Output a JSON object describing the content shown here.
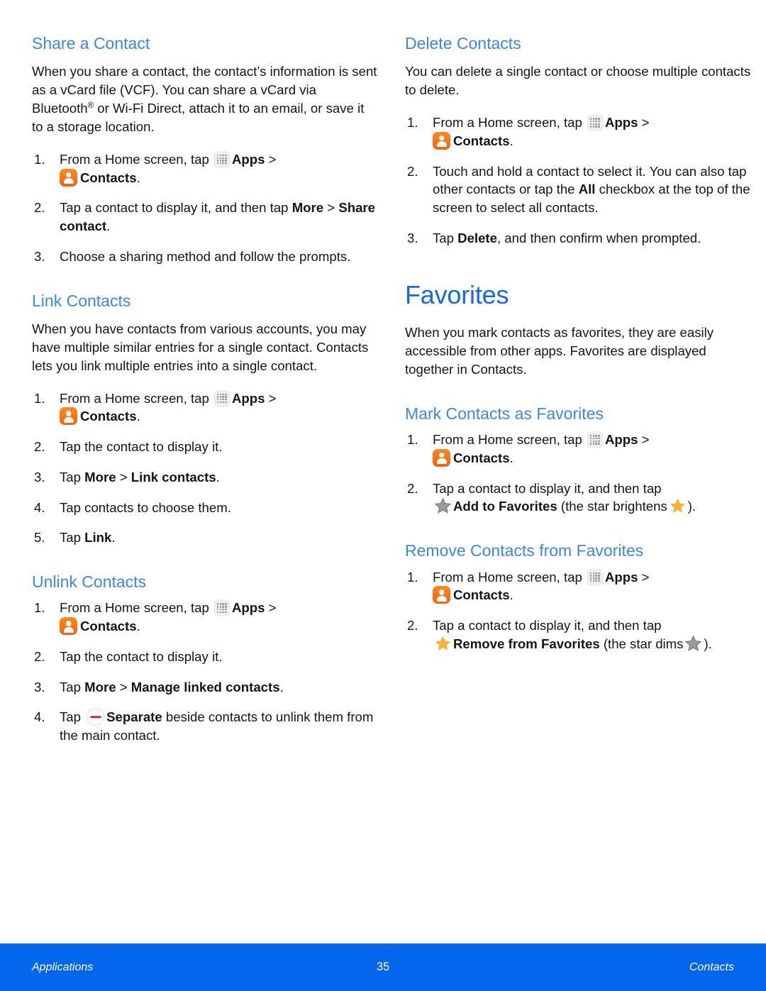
{
  "page": {
    "number": "35",
    "footer_left": "Applications",
    "footer_right": "Contacts",
    "footer_bg": "#0466ec",
    "heading_color": "#3b86f0",
    "title_color": "#1668e3"
  },
  "icons": {
    "apps": "apps-grid-icon",
    "contacts": "contacts-app-icon",
    "separate": "separate-minus-icon",
    "star_dim": "star-dim-icon",
    "star_bright": "star-bright-icon",
    "star_bright_color": "#fcb034",
    "star_dim_color": "#8d8d8d",
    "contacts_icon_color": "#f4610c",
    "separate_bar_color": "#d8232a"
  },
  "labels": {
    "apps": "Apps",
    "contacts": "Contacts",
    "separate": "Separate",
    "add_to_favorites": "Add to Favorites",
    "remove_from_favorites": "Remove from Favorites"
  },
  "left_column": {
    "share_a_contact": {
      "heading": "Share a Contact",
      "intro_1": "When you share a contact, the contact’s information is sent as a vCard file (VCF). You can share a vCard via Bluetooth",
      "intro_reg": "®",
      "intro_2": " or Wi-Fi Direct, attach it to an email, or save it to a storage location.",
      "step1_num": "1.",
      "step1_a": "From a Home screen, tap",
      "step1_b": ">",
      "step1_c": ".",
      "step2_num": "2.",
      "step2_a": "Tap a contact to display it, and then tap",
      "step2_more": "More",
      "step2_gt": ">",
      "step2_share": "Share contact",
      "step2_end": ".",
      "step3_num": "3.",
      "step3_text": "Choose a sharing method and follow the prompts."
    },
    "link_contacts": {
      "heading": "Link Contacts",
      "intro": "When you have contacts from various accounts, you may have multiple similar entries for a single contact. Contacts lets you link multiple entries into a single contact.",
      "step1_num": "1.",
      "step1_a": "From a Home screen, tap",
      "step1_b": ">",
      "step1_c": ".",
      "step2_num": "2.",
      "step2_text": "Tap the contact to display it.",
      "step3_num": "3.",
      "step3_a": "Tap",
      "step3_more": "More",
      "step3_gt": ">",
      "step3_link": "Link contacts",
      "step3_end": ".",
      "step4_num": "4.",
      "step4_text": "Tap contacts to choose them.",
      "step5_num": "5.",
      "step5_a": "Tap",
      "step5_link": "Link",
      "step5_end": "."
    },
    "unlink_contacts": {
      "heading": "Unlink Contacts",
      "step1_num": "1.",
      "step1_a": "From a Home screen, tap",
      "step1_b": ">",
      "step1_c": ".",
      "step2_num": "2.",
      "step2_text": "Tap the contact to display it.",
      "step3_num": "3.",
      "step3_a": "Tap",
      "step3_more": "More",
      "step3_gt": ">",
      "step3_manage": "Manage linked contacts",
      "step3_end": ".",
      "step4_num": "4.",
      "step4_a": "Tap",
      "step4_sep": "Separate",
      "step4_b": "beside contacts to unlink them from the main contact."
    }
  },
  "right_column": {
    "delete_contacts": {
      "heading": "Delete Contacts",
      "intro": "You can delete a single contact or choose multiple contacts to delete.",
      "step1_num": "1.",
      "step1_a": "From a Home screen, tap",
      "step1_b": ">",
      "step1_c": ".",
      "step2_num": "2.",
      "step2_a": "Touch and hold a contact to select it. You can also tap other contacts or tap the",
      "step2_all": "All",
      "step2_b": "checkbox at the top of the screen to select all contacts.",
      "step3_num": "3.",
      "step3_a": "Tap",
      "step3_delete": "Delete",
      "step3_b": ", and then confirm when prompted."
    },
    "favorites": {
      "title": "Favorites",
      "intro": "When you mark contacts as favorites, they are easily accessible from other apps. Favorites are displayed together in Contacts."
    },
    "mark_favorites": {
      "heading": "Mark Contacts as Favorites",
      "step1_num": "1.",
      "step1_a": "From a Home screen, tap",
      "step1_b": ">",
      "step1_c": ".",
      "step2_num": "2.",
      "step2_a": "Tap a contact to display it, and then tap",
      "step2_label": "Add to Favorites",
      "step2_b": "(the star brightens",
      "step2_c": ")."
    },
    "remove_favorites": {
      "heading": "Remove Contacts from Favorites",
      "step1_num": "1.",
      "step1_a": "From a Home screen, tap",
      "step1_b": ">",
      "step1_c": ".",
      "step2_num": "2.",
      "step2_a": "Tap a contact to display it, and then tap",
      "step2_label": "Remove from Favorites",
      "step2_b": "(the star dims",
      "step2_c": ")."
    }
  }
}
